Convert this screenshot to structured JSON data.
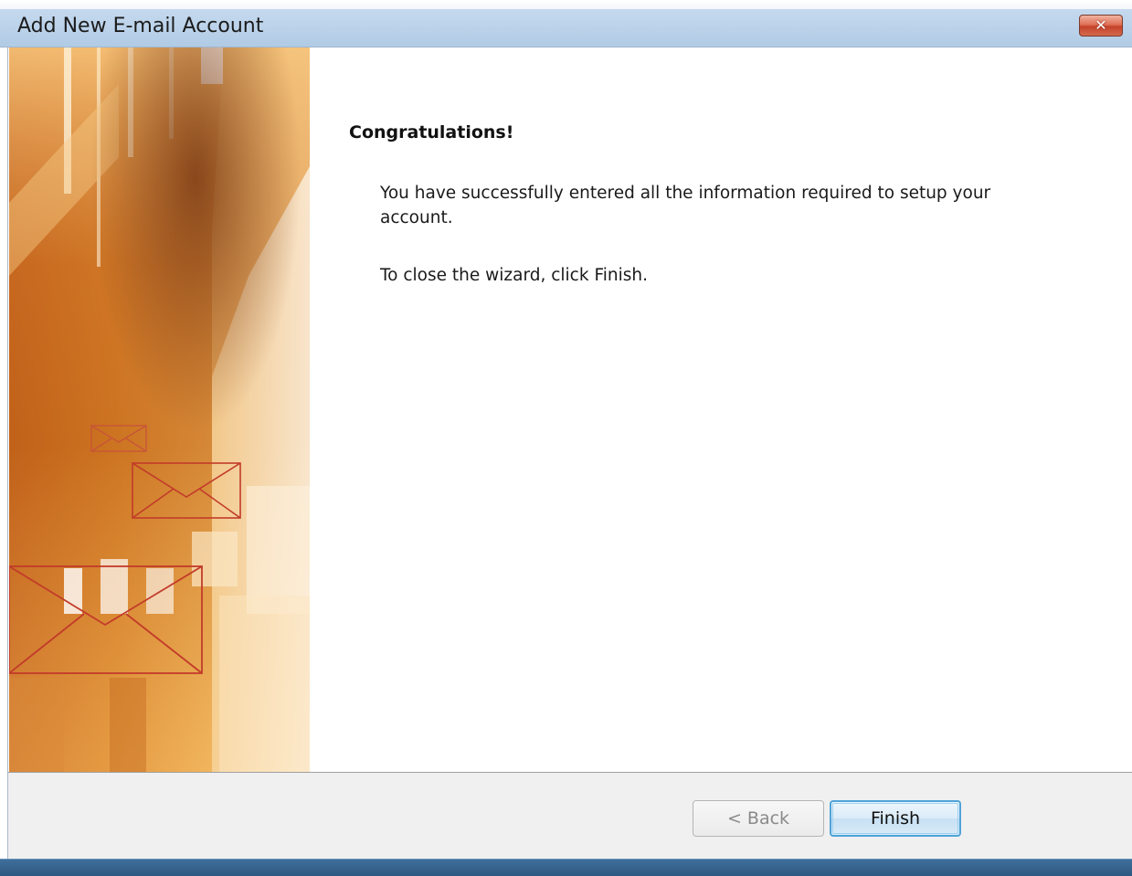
{
  "window": {
    "title": "Add New E-mail Account",
    "close_label": "✕"
  },
  "content": {
    "heading": "Congratulations!",
    "paragraph_1": "You have successfully entered all the information required to setup your account.",
    "paragraph_2": "To close the wizard, click Finish."
  },
  "footer": {
    "back_label": "< Back",
    "finish_label": "Finish",
    "back_enabled": false
  },
  "icons": {
    "close": "close-icon",
    "banner_envelopes": [
      "envelope-icon-small",
      "envelope-icon-medium",
      "envelope-icon-large"
    ]
  },
  "colors": {
    "title_bar": "#bcd3ea",
    "close_button": "#d0553b",
    "finish_border": "#4fa3d8",
    "footer_bg": "#f0f0f0",
    "banner_orange": "#e08a2c"
  }
}
